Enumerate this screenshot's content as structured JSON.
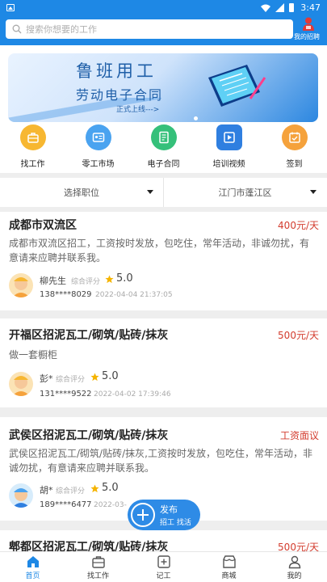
{
  "status_bar": {
    "time": "3:47"
  },
  "header": {
    "search_placeholder": "搜索你想要的工作",
    "my_recruit_label": "我的招聘"
  },
  "banner": {
    "title": "鲁班用工",
    "subtitle": "劳动电子合同",
    "note": "正式上线--->"
  },
  "menu": [
    {
      "label": "找工作",
      "icon": "briefcase-icon",
      "color": "#f7b731"
    },
    {
      "label": "零工市场",
      "icon": "id-card-icon",
      "color": "#4aa3f0"
    },
    {
      "label": "电子合同",
      "icon": "contract-icon",
      "color": "#35c07a"
    },
    {
      "label": "培训视频",
      "icon": "video-icon",
      "color": "#2f7fe0"
    },
    {
      "label": "签到",
      "icon": "calendar-check-icon",
      "color": "#f5a23c"
    }
  ],
  "filter": {
    "position": "选择职位",
    "location": "江门市蓬江区"
  },
  "jobs": [
    {
      "title": "成都市双流区",
      "salary": "400元/天",
      "description": "成都市双流区招工，工资按时发放，包吃住，常年活动，非诚勿扰，有意请来应聘并联系我。",
      "name": "柳先生",
      "rating_label": "综合评分",
      "score": "5.0",
      "phone": "138****8029",
      "time": "2022-04-04 21:37:05"
    },
    {
      "title": "开福区招泥瓦工/砌筑/贴砖/抹灰",
      "salary": "500元/天",
      "description": "做一套橱柜",
      "name": "彭*",
      "rating_label": "综合评分",
      "score": "5.0",
      "phone": "131****9522",
      "time": "2022-04-02 17:39:46"
    },
    {
      "title": "武侯区招泥瓦工/砌筑/贴砖/抹灰",
      "salary": "工资面议",
      "description": "武侯区招泥瓦工/砌筑/贴砖/抹灰,工资按时发放，包吃住，常年活动，非诚勿扰，有意请来应聘并联系我。",
      "name": "胡*",
      "rating_label": "综合评分",
      "score": "5.0",
      "phone": "189****6477",
      "time": "2022-03-"
    },
    {
      "title": "郫都区招泥瓦工/砌筑/贴砖/抹灰",
      "salary": "500元/天"
    }
  ],
  "publish": {
    "title": "发布",
    "subtitle": "招工 找活"
  },
  "tabbar": [
    {
      "label": "首页",
      "icon": "home-icon",
      "active": true
    },
    {
      "label": "找工作",
      "icon": "briefcase-icon"
    },
    {
      "label": "记工",
      "icon": "plus-square-icon"
    },
    {
      "label": "商城",
      "icon": "shop-icon"
    },
    {
      "label": "我的",
      "icon": "person-icon"
    }
  ],
  "colors": {
    "primary": "#1e88e5",
    "salary": "#d33c2e",
    "star": "#f5b400"
  }
}
